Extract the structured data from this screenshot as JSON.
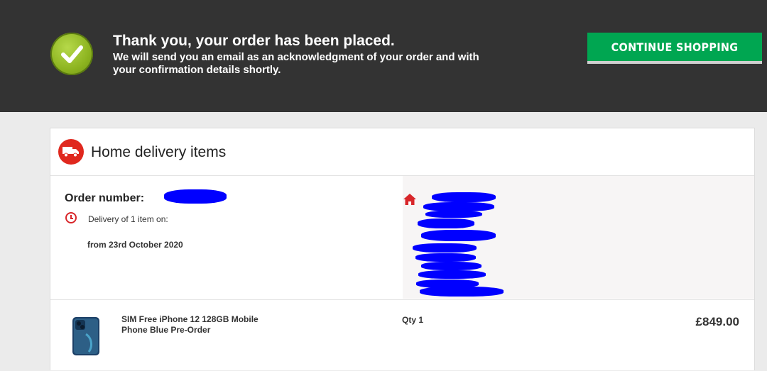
{
  "banner": {
    "title": "Thank you, your order has been placed.",
    "message": "We will send you an email as an acknowledgment of your order and with your confirmation details shortly.",
    "continue_label": "CONTINUE SHOPPING",
    "accent_color": "#00a651",
    "background_color": "#333333"
  },
  "delivery": {
    "section_title": "Home delivery items",
    "order_number_label": "Order number:",
    "delivery_text": "Delivery of 1 item on:",
    "delivery_date": "from 23rd October 2020",
    "section_icon": "truck-icon",
    "address_icon": "house-icon",
    "icon_color": "#e0281e"
  },
  "item": {
    "name": "SIM Free iPhone 12 128GB Mobile Phone Blue Pre-Order",
    "qty": "Qty 1",
    "price": "£849.00"
  }
}
